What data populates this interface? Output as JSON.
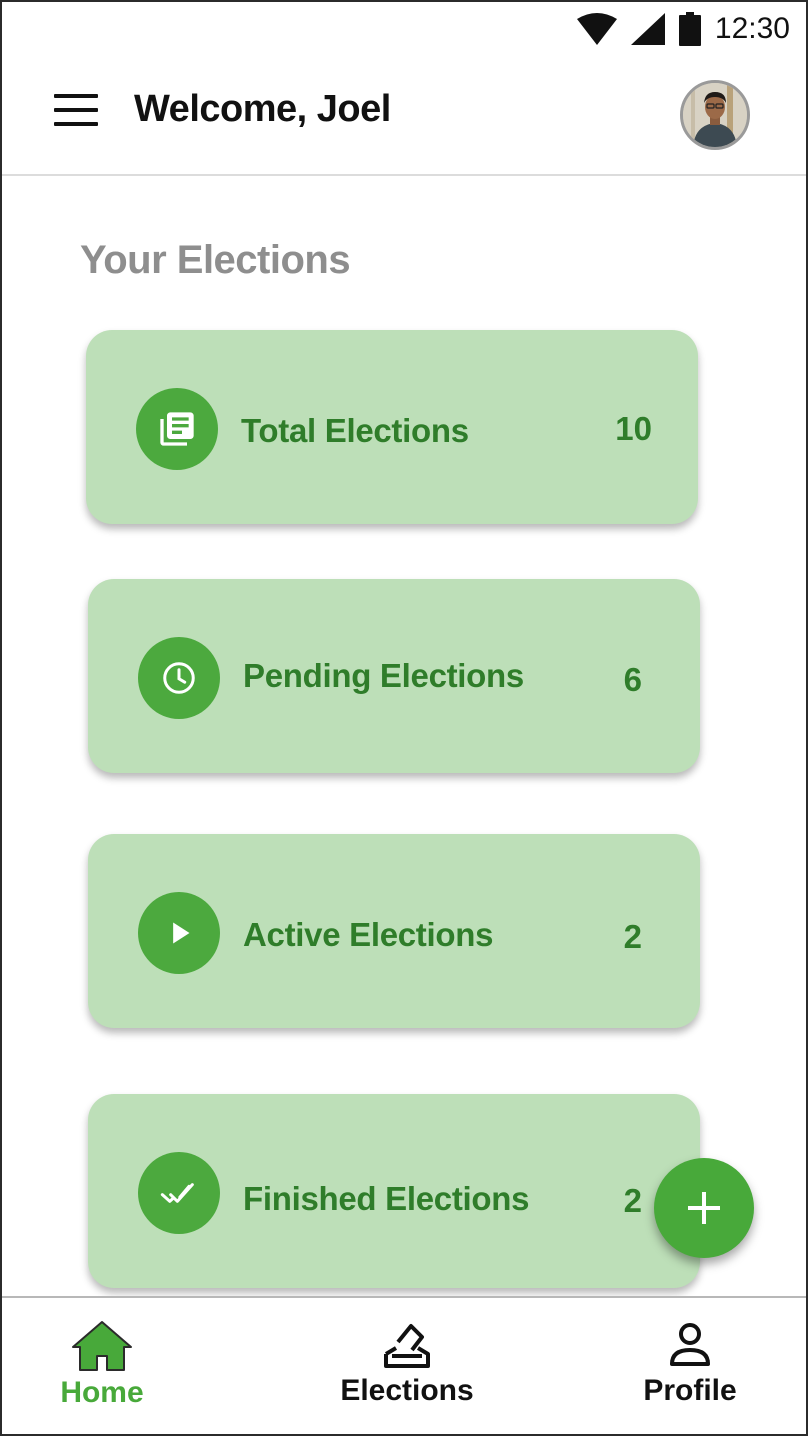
{
  "status_bar": {
    "time": "12:30"
  },
  "app_bar": {
    "welcome_text": "Welcome, Joel"
  },
  "section": {
    "title": "Your Elections"
  },
  "cards": [
    {
      "label": "Total Elections",
      "count": "10",
      "icon": "list-icon"
    },
    {
      "label": "Pending Elections",
      "count": "6",
      "icon": "clock-icon"
    },
    {
      "label": "Active Elections",
      "count": "2",
      "icon": "play-icon"
    },
    {
      "label": "Finished Elections",
      "count": "2",
      "icon": "double-check-icon"
    }
  ],
  "bottom_nav": {
    "items": [
      {
        "label": "Home",
        "icon": "home-icon",
        "active": true
      },
      {
        "label": "Elections",
        "icon": "ballot-icon",
        "active": false
      },
      {
        "label": "Profile",
        "icon": "person-icon",
        "active": false
      }
    ]
  },
  "colors": {
    "accent": "#48a93a",
    "card_background": "#bddfb8",
    "card_text": "#2f7d2a",
    "section_title": "#8e8e8e"
  }
}
